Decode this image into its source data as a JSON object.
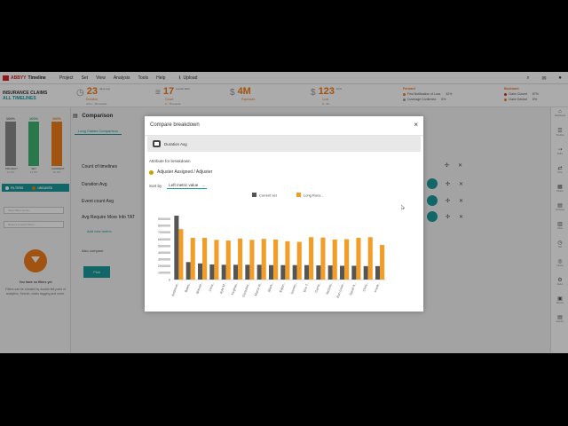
{
  "app": {
    "logo_brand": "ABBYY",
    "logo_product": "Timeline",
    "menu": [
      "Project",
      "Set",
      "View",
      "Analysis",
      "Tools",
      "Help"
    ],
    "upload_label": "Upload",
    "top_icons": [
      "search-icon",
      "mail-icon",
      "user-icon"
    ]
  },
  "stats": {
    "title_line1": "INSURANCE CLAIMS",
    "title_line2": "ALL TIMELINES",
    "duration": {
      "value": "23",
      "unit": "days avg",
      "label": "Duration",
      "sub": "4 hrs - 15 months"
    },
    "events": {
      "value": "17",
      "unit": "events Web",
      "label": "Count",
      "sub": "3 - 79 events"
    },
    "expenses": {
      "symbol": "$",
      "value": "4M",
      "unit": "",
      "label": "Expenses",
      "sub": ""
    },
    "cost": {
      "symbol": "$",
      "value": "123",
      "unit": "AVG",
      "label": "Cost",
      "sub": "0 - 3K"
    },
    "forward": {
      "title": "Forward",
      "rows": [
        {
          "label": "First Notification of Loss",
          "value": "42%",
          "color": "#f07c1b"
        },
        {
          "label": "Coverage Confirmed",
          "value": "5%",
          "color": "#999999"
        }
      ]
    },
    "backward": {
      "title": "Backward",
      "rows": [
        {
          "label": "Claim Closed",
          "value": "87%",
          "color": "#d8232a"
        },
        {
          "label": "Claim Denied",
          "value": "8%",
          "color": "#f07c1b"
        }
      ]
    }
  },
  "left_panel": {
    "bars": [
      {
        "pct": "100%",
        "label": "PROJECT",
        "sub": "21.9%",
        "color": "#8a8a8a"
      },
      {
        "pct": "100%",
        "label": "SET",
        "sub": "21.9%",
        "color": "#3cb371"
      },
      {
        "pct": "100%",
        "label": "CURRENT",
        "sub": "21.9%",
        "color": "#f07c1b"
      }
    ],
    "filters_label": "FILTERS",
    "unsaved_label": "UNSAVED",
    "input1": "Save filters set as...",
    "input2": "Restore a saved filters...",
    "no_filters_title": "You have no filters yet",
    "no_filters_text": "Filters can be created by double left parts of analytics. Search, clicks tagging and more."
  },
  "main": {
    "title": "Comparison",
    "tab": "Long Claims Comparison",
    "metrics": [
      "Count of timelines",
      "Duration Avg",
      "Event count Avg",
      "Avg Require More Info TAT"
    ],
    "add_metric": "Add new metric",
    "also_compare": "Also compare",
    "pick_button": "Pick"
  },
  "right_bar": [
    {
      "icon": "home-icon",
      "cap": "Dashboard"
    },
    {
      "icon": "timeline-icon",
      "cap": "Timeline"
    },
    {
      "icon": "path-icon",
      "cap": "Paths"
    },
    {
      "icon": "flow-icon",
      "cap": "Flow"
    },
    {
      "icon": "pattern-icon",
      "cap": "Pattern"
    },
    {
      "icon": "compare-icon",
      "cap": "Compare"
    },
    {
      "icon": "table-icon",
      "cap": "Table"
    },
    {
      "icon": "tat-icon",
      "cap": "TAT"
    },
    {
      "icon": "cluster-icon",
      "cap": "Cluster"
    },
    {
      "icon": "rule-icon",
      "cap": "Rules"
    },
    {
      "icon": "monitor-icon",
      "cap": "Monitor"
    },
    {
      "icon": "report-icon",
      "cap": "Reports"
    }
  ],
  "modal": {
    "title": "Compare breakdown",
    "close_label": "×",
    "metric_name": "Duration Avg",
    "attr_label": "Attribute for breakdown",
    "attr_value": "Adjuster Assigned / Adjuster",
    "sort_label": "Sort by",
    "sort_value": "Left metric value",
    "chart_data": {
      "type": "bar",
      "series": [
        {
          "name": "Current set",
          "color": "#555555",
          "values": [
            9500000,
            2600000,
            2400000,
            2250000,
            2200000,
            2200000,
            2200000,
            2200000,
            2150000,
            2150000,
            2150000,
            2150000,
            2100000,
            2100000,
            2050000,
            2050000,
            2000000,
            2000000
          ]
        },
        {
          "name": "Long Runs...",
          "color": "#f39c26",
          "values": [
            7500000,
            6200000,
            6200000,
            5900000,
            5800000,
            6100000,
            5900000,
            6050000,
            5950000,
            5700000,
            5600000,
            6300000,
            6250000,
            5950000,
            6000000,
            6200000,
            6300000,
            5150000
          ]
        }
      ],
      "categories": [
        "Andrews...",
        "Bates...",
        "Brewst...",
        "Chris...",
        "Kyle M...",
        "Hughes...",
        "Gonzalez...",
        "Marco N...",
        "Black...",
        "Eaton...",
        "Gomez...",
        "Eric T...",
        "Garris...",
        "Nichols...",
        "Ron Lowe...",
        "Sarah K...",
        "Chris...",
        "Frank..."
      ],
      "y_ticks": [
        "9000000",
        "8000000",
        "7000000",
        "6000000",
        "5000000",
        "4000000",
        "3000000",
        "2000000",
        "1000000",
        "0"
      ],
      "ylim": [
        0,
        9500000
      ]
    }
  }
}
